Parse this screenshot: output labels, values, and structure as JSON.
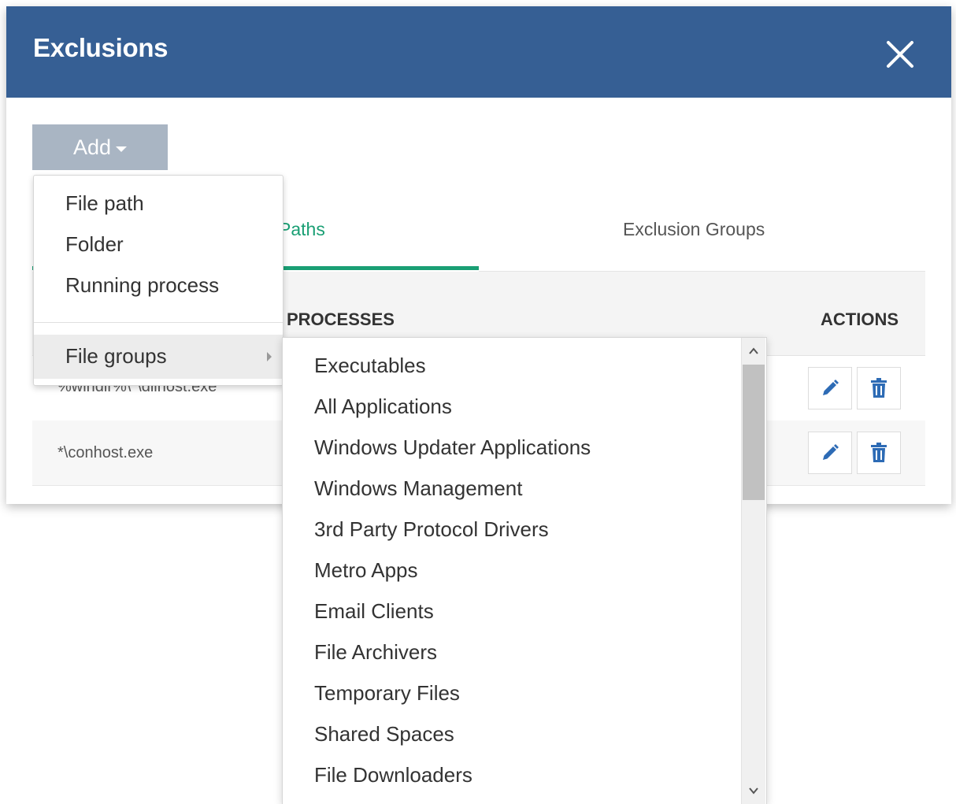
{
  "dialog": {
    "title": "Exclusions",
    "close_icon": "close-icon"
  },
  "toolbar": {
    "add_label": "Add"
  },
  "tabs": [
    {
      "label": "Paths",
      "active": true
    },
    {
      "label": "Exclusion Groups",
      "active": false
    }
  ],
  "table": {
    "columns": [
      "PROCESSES",
      "ACTIONS"
    ],
    "rows": [
      {
        "path": "%windir%\\*\\dllhost.exe"
      },
      {
        "path": "*\\conhost.exe"
      }
    ],
    "action_icons": [
      "pencil-icon",
      "trash-icon"
    ]
  },
  "add_menu": {
    "items": [
      "File path",
      "Folder",
      "Running process"
    ],
    "submenu_label": "File groups"
  },
  "file_groups": [
    "Executables",
    "All Applications",
    "Windows Updater Applications",
    "Windows Management",
    "3rd Party Protocol Drivers",
    "Metro Apps",
    "Email Clients",
    "File Archivers",
    "Temporary Files",
    "Shared Spaces",
    "File Downloaders"
  ],
  "colors": {
    "header": "#365f94",
    "accent": "#1a9f74",
    "add_button": "#a9b5c3",
    "icon_blue": "#2d6bb5"
  }
}
